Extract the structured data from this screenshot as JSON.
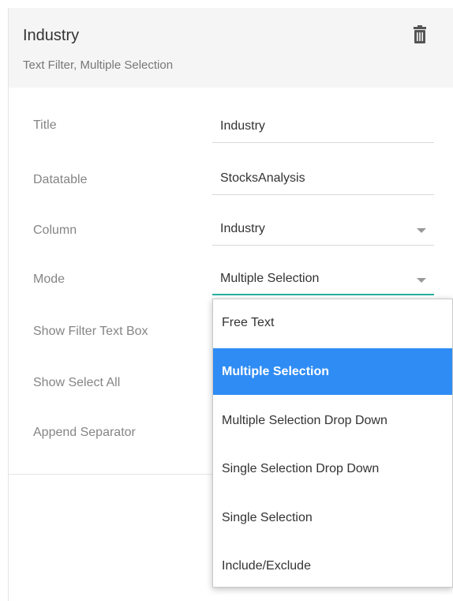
{
  "header": {
    "title": "Industry",
    "subtitle": "Text Filter, Multiple Selection",
    "delete_icon": "trash-icon"
  },
  "form": {
    "title_label": "Title",
    "title_value": "Industry",
    "datatable_label": "Datatable",
    "datatable_value": "StocksAnalysis",
    "column_label": "Column",
    "column_value": "Industry",
    "mode_label": "Mode",
    "mode_value": "Multiple Selection",
    "show_filter_text_box_label": "Show Filter Text Box",
    "show_select_all_label": "Show Select All",
    "append_separator_label": "Append Separator"
  },
  "mode_dropdown": {
    "options": [
      "Free Text",
      "Multiple Selection",
      "Multiple Selection Drop Down",
      "Single Selection Drop Down",
      "Single Selection",
      "Include/Exclude"
    ],
    "selected": "Multiple Selection"
  },
  "colors": {
    "accent_focus": "#2bb0a2",
    "selected_bg": "#2f8cf4"
  }
}
